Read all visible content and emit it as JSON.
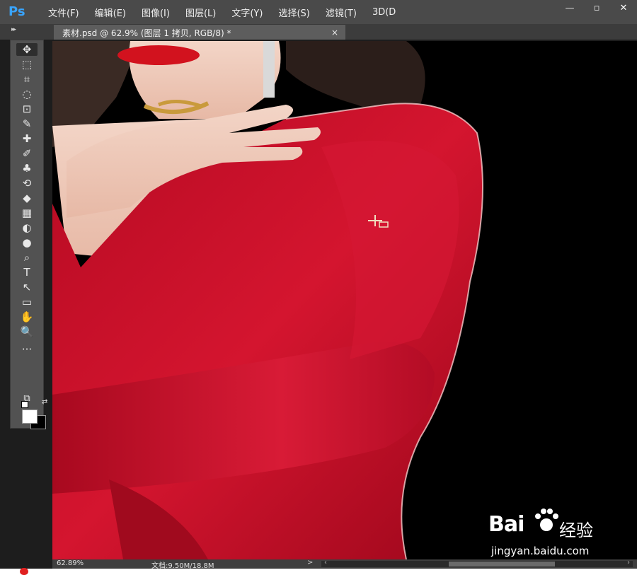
{
  "app": {
    "logo_text": "Ps",
    "menus": [
      "文件(F)",
      "编辑(E)",
      "图像(I)",
      "图层(L)",
      "文字(Y)",
      "选择(S)",
      "滤镜(T)",
      "3D(D"
    ],
    "window_controls": {
      "minimize": "—",
      "restore": "▫",
      "close": "✕"
    }
  },
  "document_tab": {
    "title": "素材.psd @ 62.9% (图层 1 拷贝, RGB/8) *",
    "close": "×"
  },
  "toolbar": {
    "collapse": "▸▸",
    "tools": [
      "✥",
      "⬚",
      "⌗",
      "◌",
      "⊡",
      "✎",
      "✚",
      "✐",
      "♣",
      "⟲",
      "◆",
      "▦",
      "◐",
      "●",
      "⌕",
      "T",
      "↖",
      "▭",
      "✋",
      "🔍",
      "···",
      "⧉",
      "▣"
    ]
  },
  "status_bar": {
    "zoom": "62.89%",
    "doc_info": "文档:9.50M/18.8M",
    "arrow": ">"
  },
  "watermark": {
    "brand": "Bai",
    "brand_cn": "经验",
    "url": "jingyan.baidu.com"
  },
  "colors": {
    "menubar": "#4a4a4a",
    "canvas_bg": "#000000",
    "dress_red": "#c8102e",
    "ps_blue": "#39a4ff"
  }
}
